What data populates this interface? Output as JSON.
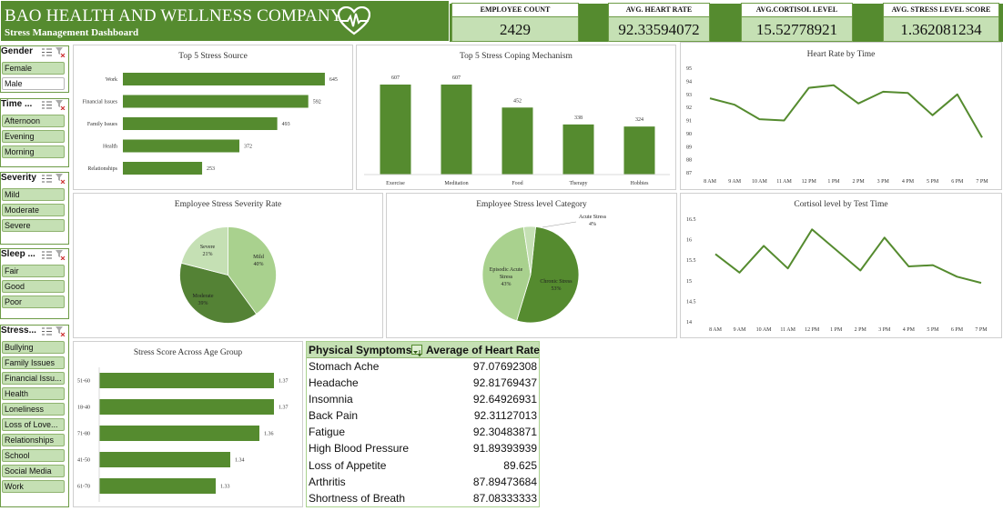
{
  "header": {
    "title": "BAO HEALTH AND WELLNESS COMPANY",
    "subtitle": "Stress Management Dashboard",
    "logo_icon": "heartbeat-icon"
  },
  "kpis": [
    {
      "label": "EMPLOYEE COUNT",
      "value": "2429"
    },
    {
      "label": "AVG. HEART RATE",
      "value": "92.33594072"
    },
    {
      "label": "AVG.CORTISOL LEVEL",
      "value": "15.52778921"
    },
    {
      "label": "AVG. STRESS LEVEL SCORE",
      "value": "1.362081234"
    }
  ],
  "slicers": {
    "gender": {
      "title": "Gender",
      "items": [
        {
          "label": "Female",
          "selected": true
        },
        {
          "label": "Male",
          "selected": false
        }
      ]
    },
    "time": {
      "title": "Time ...",
      "items": [
        {
          "label": "Afternoon",
          "selected": true
        },
        {
          "label": "Evening",
          "selected": true
        },
        {
          "label": "Morning",
          "selected": true
        }
      ]
    },
    "severity": {
      "title": "Severity",
      "items": [
        {
          "label": "Mild",
          "selected": true
        },
        {
          "label": "Moderate",
          "selected": true
        },
        {
          "label": "Severe",
          "selected": true
        }
      ]
    },
    "sleep": {
      "title": "Sleep ...",
      "items": [
        {
          "label": "Fair",
          "selected": true
        },
        {
          "label": "Good",
          "selected": true
        },
        {
          "label": "Poor",
          "selected": true
        }
      ]
    },
    "stress": {
      "title": "Stress...",
      "items": [
        {
          "label": "Bullying",
          "selected": true
        },
        {
          "label": "Family Issues",
          "selected": true
        },
        {
          "label": "Financial Issu...",
          "selected": true
        },
        {
          "label": "Health",
          "selected": true
        },
        {
          "label": "Loneliness",
          "selected": true
        },
        {
          "label": "Loss of Love...",
          "selected": true
        },
        {
          "label": "Relationships",
          "selected": true
        },
        {
          "label": "School",
          "selected": true
        },
        {
          "label": "Social Media",
          "selected": true
        },
        {
          "label": "Work",
          "selected": true
        }
      ]
    },
    "icons": {
      "multiselect": "multi-select-icon",
      "clear": "clear-filter-icon"
    }
  },
  "colors": {
    "accent": "#558b2f",
    "light": "#c5e0b4",
    "pie_mild": "#a9d18e",
    "pie_moderate": "#548235",
    "pie_severe": "#c5e0b4"
  },
  "chart_data": [
    {
      "id": "stress_source",
      "type": "bar",
      "title": "Top 5 Stress Source",
      "orientation": "horizontal",
      "categories": [
        "Work",
        "Financial Issues",
        "Family Issues",
        "Health",
        "Relationships"
      ],
      "values": [
        645,
        592,
        493,
        372,
        253
      ],
      "value_labels": [
        "645",
        "592",
        "493",
        "372",
        "253"
      ],
      "xlim": [
        0,
        700
      ]
    },
    {
      "id": "coping",
      "type": "bar",
      "title": "Top 5 Stress Coping Mechanism",
      "categories": [
        "Exercise",
        "Meditation",
        "Food",
        "Therapy",
        "Hobbies"
      ],
      "values": [
        607,
        607,
        452,
        338,
        324
      ],
      "value_labels": [
        "607",
        "607",
        "452",
        "338",
        "324"
      ],
      "ylim": [
        0,
        650
      ]
    },
    {
      "id": "heart_rate",
      "type": "line",
      "title": "Heart Rate by Time",
      "x": [
        "8 AM",
        "9 AM",
        "10 AM",
        "11 AM",
        "12 PM",
        "1 PM",
        "2 PM",
        "3 PM",
        "4 PM",
        "5 PM",
        "6 PM",
        "7 PM"
      ],
      "y": [
        92.7,
        92.2,
        91.1,
        91.0,
        93.5,
        93.7,
        92.3,
        93.2,
        93.1,
        91.4,
        93.0,
        89.7
      ],
      "ylim": [
        87,
        95
      ],
      "yticks": [
        "87",
        "88",
        "89",
        "90",
        "91",
        "92",
        "93",
        "94",
        "95"
      ]
    },
    {
      "id": "severity",
      "type": "pie",
      "title": "Employee Stress Severity Rate",
      "slices": [
        {
          "label": "Mild",
          "pct_label": "40%",
          "value": 40
        },
        {
          "label": "Moderate",
          "pct_label": "39%",
          "value": 39
        },
        {
          "label": "Severe",
          "pct_label": "21%",
          "value": 21
        }
      ]
    },
    {
      "id": "category",
      "type": "pie",
      "title": "Employee Stress level Category",
      "slices": [
        {
          "label": "Chronic Stress",
          "pct_label": "53%",
          "value": 53
        },
        {
          "label": "Episodic Acute Stress",
          "pct_label": "43%",
          "value": 43
        },
        {
          "label": "Acute Stress",
          "pct_label": "4%",
          "value": 4
        }
      ]
    },
    {
      "id": "cortisol",
      "type": "line",
      "title": "Cortisol level by Test Time",
      "x": [
        "8 AM",
        "9 AM",
        "10 AM",
        "11 AM",
        "12 PM",
        "1 PM",
        "2 PM",
        "3 PM",
        "4 PM",
        "5 PM",
        "6 PM",
        "7 PM"
      ],
      "y": [
        15.65,
        15.2,
        15.85,
        15.3,
        16.25,
        15.75,
        15.25,
        16.05,
        15.35,
        15.38,
        15.1,
        14.95
      ],
      "ylim": [
        14,
        16.5
      ],
      "yticks": [
        "14",
        "14.5",
        "15",
        "15.5",
        "16",
        "16.5"
      ]
    },
    {
      "id": "age_group",
      "type": "bar",
      "title": "Stress Score Across Age Group",
      "orientation": "horizontal",
      "categories": [
        "51-60",
        "18-40",
        "71-80",
        "41-50",
        "61-70"
      ],
      "values": [
        1.37,
        1.37,
        1.36,
        1.34,
        1.33
      ],
      "value_labels": [
        "1.37",
        "1.37",
        "1.36",
        "1.34",
        "1.33"
      ],
      "xlim": [
        1.25,
        1.38
      ]
    }
  ],
  "table": {
    "col1": "Physical Symptoms",
    "col2": "Average of Heart Rate",
    "filter_icon": "filter-sort-icon",
    "rows": [
      {
        "symptom": "Stomach Ache",
        "value": "97.07692308"
      },
      {
        "symptom": "Headache",
        "value": "92.81769437"
      },
      {
        "symptom": "Insomnia",
        "value": "92.64926931"
      },
      {
        "symptom": "Back Pain",
        "value": "92.31127013"
      },
      {
        "symptom": "Fatigue",
        "value": "92.30483871"
      },
      {
        "symptom": "High Blood Pressure",
        "value": "91.89393939"
      },
      {
        "symptom": "Loss of Appetite",
        "value": "89.625"
      },
      {
        "symptom": "Arthritis",
        "value": "87.89473684"
      },
      {
        "symptom": "Shortness of Breath",
        "value": "87.08333333"
      }
    ]
  }
}
